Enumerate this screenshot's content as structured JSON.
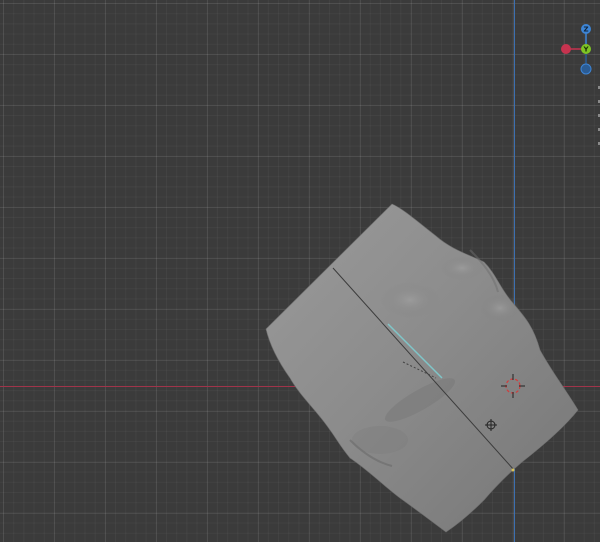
{
  "viewport": {
    "background_color": "#3b3b3b",
    "x_axis_color": "#a0344a",
    "y_axis_color": "#3c6fb0"
  },
  "navigation_gizmo": {
    "z_label": "Z",
    "y_label": "Y",
    "x_label": "",
    "neg_y_label": "",
    "x_color": "#c6334f",
    "y_color": "#7ec524",
    "z_color": "#3d85d6",
    "neg_color": "#2b5c94"
  },
  "object": {
    "name_icon": "sculpt-mesh",
    "mesh_color": "#8a8a8a",
    "seam_color": "#7fc6c9"
  },
  "markers": {
    "cursor_icon": "3d-cursor-icon",
    "origin_icon": "object-origin-icon"
  }
}
